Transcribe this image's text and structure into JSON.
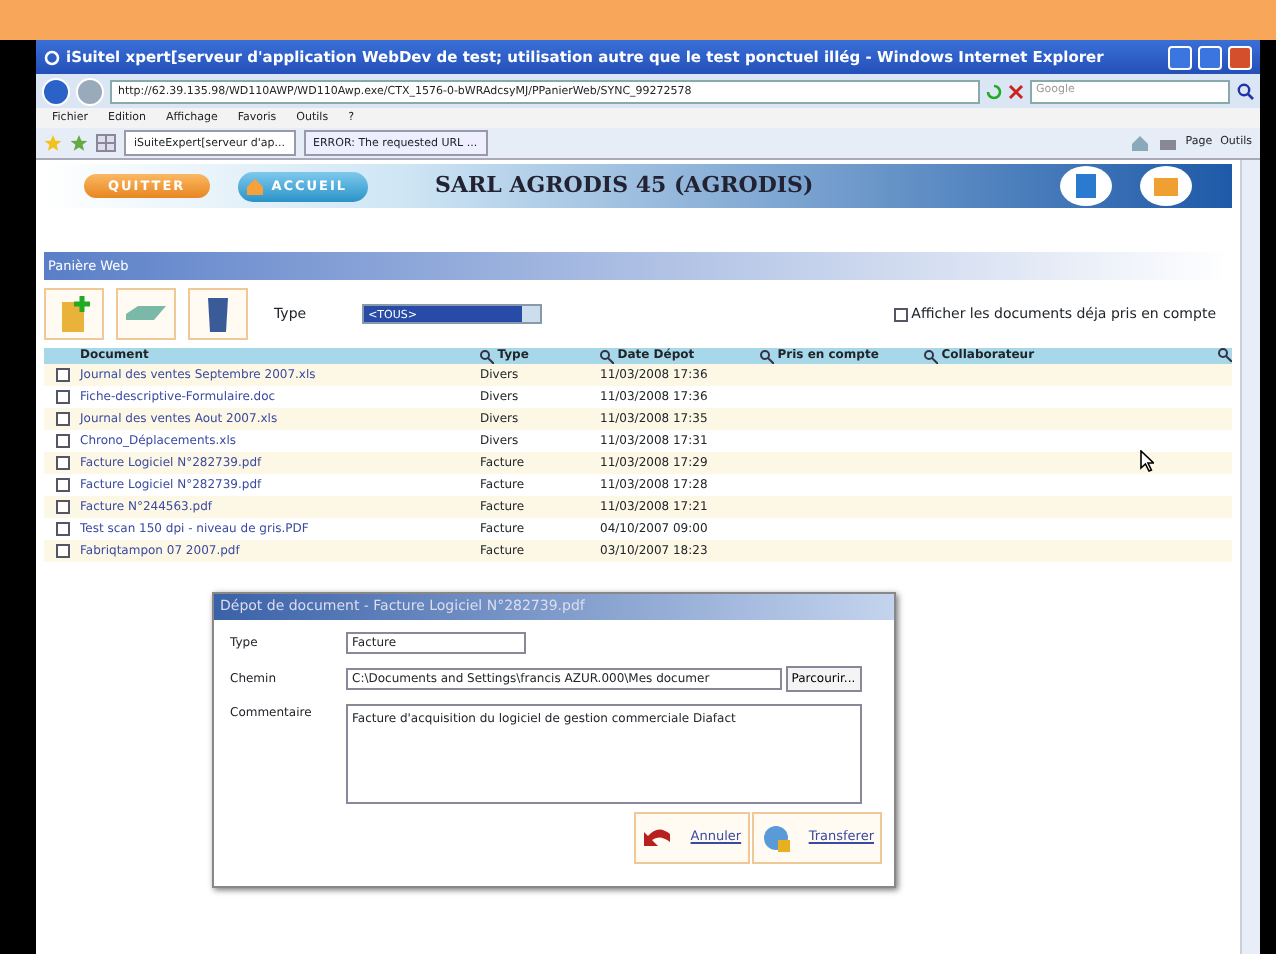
{
  "window": {
    "title": "iSuitel xpert[serveur d'application WebDev de test; utilisation autre que le test ponctuel illég - Windows Internet Explorer"
  },
  "address_bar": {
    "url": "http://62.39.135.98/WD110AWP/WD110Awp.exe/CTX_1576-0-bWRAdcsyMJ/PPanierWeb/SYNC_99272578",
    "search_placeholder": "Google"
  },
  "menu": [
    "Fichier",
    "Edition",
    "Affichage",
    "Favoris",
    "Outils",
    "?"
  ],
  "tabs": [
    {
      "label": "iSuiteExpert[serveur d'ap...",
      "selected": true
    },
    {
      "label": "ERROR: The requested URL ...",
      "selected": false
    }
  ],
  "command_bar": [
    "Page",
    "Outils"
  ],
  "banner": {
    "quit": "QUITTER",
    "home": "ACCUEIL",
    "company": "SARL AGRODIS 45 (AGRODIS)"
  },
  "panel": {
    "title": "Panière Web",
    "type_label": "Type",
    "type_value": "<TOUS>",
    "show_processed": {
      "label": "Afficher les documents déja pris en compte",
      "checked": false
    }
  },
  "table": {
    "columns": [
      "Document",
      "Type",
      "Date Dépot",
      "Pris en compte",
      "Collaborateur"
    ],
    "rows": [
      {
        "checked": false,
        "document": "Journal des ventes Septembre 2007.xls",
        "type": "Divers",
        "date": "11/03/2008 17:36"
      },
      {
        "checked": false,
        "document": "Fiche-descriptive-Formulaire.doc",
        "type": "Divers",
        "date": "11/03/2008 17:36"
      },
      {
        "checked": false,
        "document": "Journal des ventes Aout 2007.xls",
        "type": "Divers",
        "date": "11/03/2008 17:35"
      },
      {
        "checked": false,
        "document": "Chrono_Déplacements.xls",
        "type": "Divers",
        "date": "11/03/2008 17:31"
      },
      {
        "checked": false,
        "document": "Facture Logiciel N°282739.pdf",
        "type": "Facture",
        "date": "11/03/2008 17:29"
      },
      {
        "checked": false,
        "document": "Facture Logiciel N°282739.pdf",
        "type": "Facture",
        "date": "11/03/2008 17:28"
      },
      {
        "checked": false,
        "document": "Facture N°244563.pdf",
        "type": "Facture",
        "date": "11/03/2008 17:21"
      },
      {
        "checked": false,
        "document": "Test scan 150 dpi - niveau de gris.PDF",
        "type": "Facture",
        "date": "04/10/2007 09:00"
      },
      {
        "checked": false,
        "document": "Fabriqtampon 07 2007.pdf",
        "type": "Facture",
        "date": "03/10/2007 18:23"
      }
    ]
  },
  "dialog": {
    "title": "Dépot de document - Facture Logiciel N°282739.pdf",
    "type_label": "Type",
    "type_value": "Facture",
    "path_label": "Chemin",
    "path_value": "C:\\Documents and Settings\\francis AZUR.000\\Mes documer",
    "browse": "Parcourir...",
    "comment_label": "Commentaire",
    "comment_value": "Facture d'acquisition du logiciel de gestion commerciale Diafact",
    "cancel": "Annuler",
    "transfer": "Transferer"
  }
}
